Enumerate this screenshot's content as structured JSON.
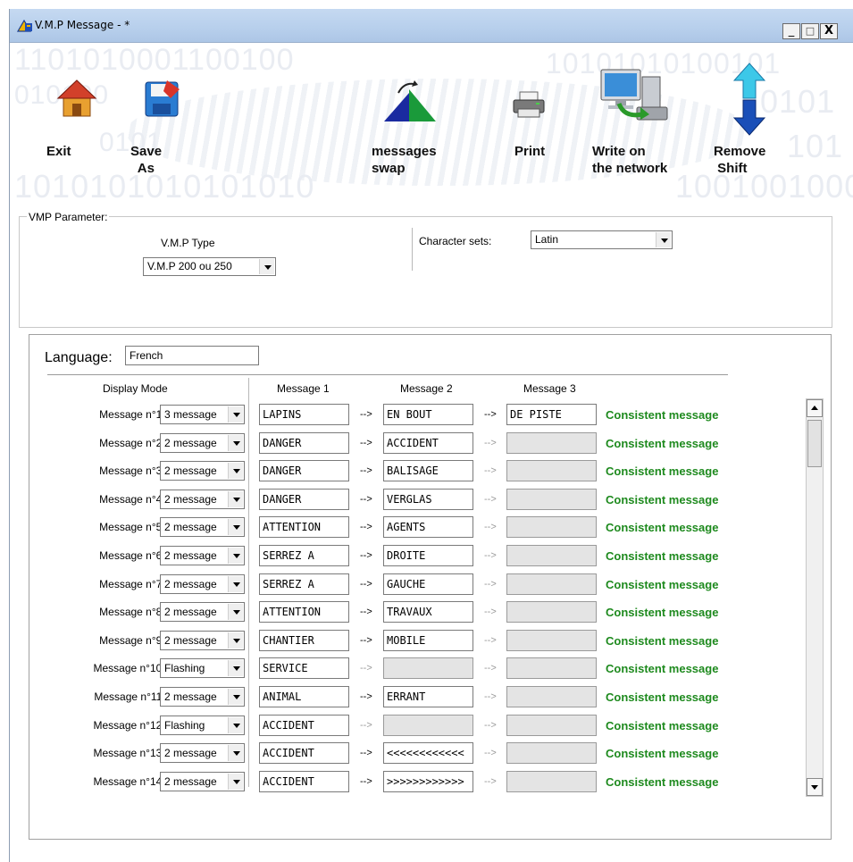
{
  "window": {
    "title": "V.M.P Message -  *",
    "minimize": "_",
    "maximize": "□",
    "close": "X"
  },
  "toolbar": {
    "background_text": [
      "1101010001100100",
      "010100",
      "0101",
      "1010101010101010",
      "1001001000",
      "101",
      "0101",
      "10101010100101"
    ],
    "exit": {
      "label": "Exit",
      "icon": "house-icon"
    },
    "save_as": {
      "label": "Save\n  As",
      "icon": "floppy-disk-icon"
    },
    "swap": {
      "label": "messages\nswap",
      "icon": "swap-triangle-icon"
    },
    "print": {
      "label": "Print",
      "icon": "printer-icon"
    },
    "network": {
      "label": "Write on\nthe network",
      "icon": "network-computer-icon"
    },
    "shift": {
      "label": "Remove\n Shift",
      "icon": "up-down-arrow-icon"
    }
  },
  "params": {
    "legend": "VMP Parameter:",
    "vmp_type_label": "V.M.P Type",
    "vmp_type_value": "V.M.P 200 ou 250",
    "charset_label": "Character sets:",
    "charset_value": "Latin"
  },
  "messages": {
    "language_label": "Language:",
    "language_value": "French",
    "headers": {
      "display_mode": "Display Mode",
      "message1": "Message 1",
      "message2": "Message 2",
      "message3": "Message 3"
    },
    "arrow": "-->",
    "rows": [
      {
        "label": "Message n°1 :",
        "mode": "3 message",
        "m1": "LAPINS",
        "m2": "EN BOUT",
        "m3": "DE PISTE",
        "status": "Consistent message"
      },
      {
        "label": "Message n°2 :",
        "mode": "2 message",
        "m1": "DANGER",
        "m2": "ACCIDENT",
        "m3": "",
        "status": "Consistent message"
      },
      {
        "label": "Message n°3 :",
        "mode": "2 message",
        "m1": "DANGER",
        "m2": "BALISAGE",
        "m3": "",
        "status": "Consistent message"
      },
      {
        "label": "Message n°4 :",
        "mode": "2 message",
        "m1": "DANGER",
        "m2": "VERGLAS",
        "m3": "",
        "status": "Consistent message"
      },
      {
        "label": "Message n°5 :",
        "mode": "2 message",
        "m1": "ATTENTION",
        "m2": "AGENTS",
        "m3": "",
        "status": "Consistent message"
      },
      {
        "label": "Message n°6 :",
        "mode": "2 message",
        "m1": "SERREZ A",
        "m2": "DROITE",
        "m3": "",
        "status": "Consistent message"
      },
      {
        "label": "Message n°7 :",
        "mode": "2 message",
        "m1": "SERREZ A",
        "m2": "GAUCHE",
        "m3": "",
        "status": "Consistent message"
      },
      {
        "label": "Message n°8 :",
        "mode": "2 message",
        "m1": "ATTENTION",
        "m2": "TRAVAUX",
        "m3": "",
        "status": "Consistent message"
      },
      {
        "label": "Message n°9 :",
        "mode": "2 message",
        "m1": "CHANTIER",
        "m2": "MOBILE",
        "m3": "",
        "status": "Consistent message"
      },
      {
        "label": "Message n°10 :",
        "mode": "Flashing",
        "m1": "SERVICE",
        "m2": "",
        "m3": "",
        "status": "Consistent message"
      },
      {
        "label": "Message n°11 :",
        "mode": "2 message",
        "m1": "ANIMAL",
        "m2": "ERRANT",
        "m3": "",
        "status": "Consistent message"
      },
      {
        "label": "Message n°12 :",
        "mode": "Flashing",
        "m1": "ACCIDENT",
        "m2": "",
        "m3": "",
        "status": "Consistent message"
      },
      {
        "label": "Message n°13 :",
        "mode": "2 message",
        "m1": "ACCIDENT",
        "m2": "<<<<<<<<<<<<",
        "m3": "",
        "status": "Consistent message"
      },
      {
        "label": "Message n°14 :",
        "mode": "2 message",
        "m1": "ACCIDENT",
        "m2": ">>>>>>>>>>>>",
        "m3": "",
        "status": "Consistent message"
      }
    ]
  },
  "colors": {
    "status_ok": "#1e8a1e",
    "titlebar": "#b7cfec",
    "empty_field": "#e4e4e4"
  }
}
